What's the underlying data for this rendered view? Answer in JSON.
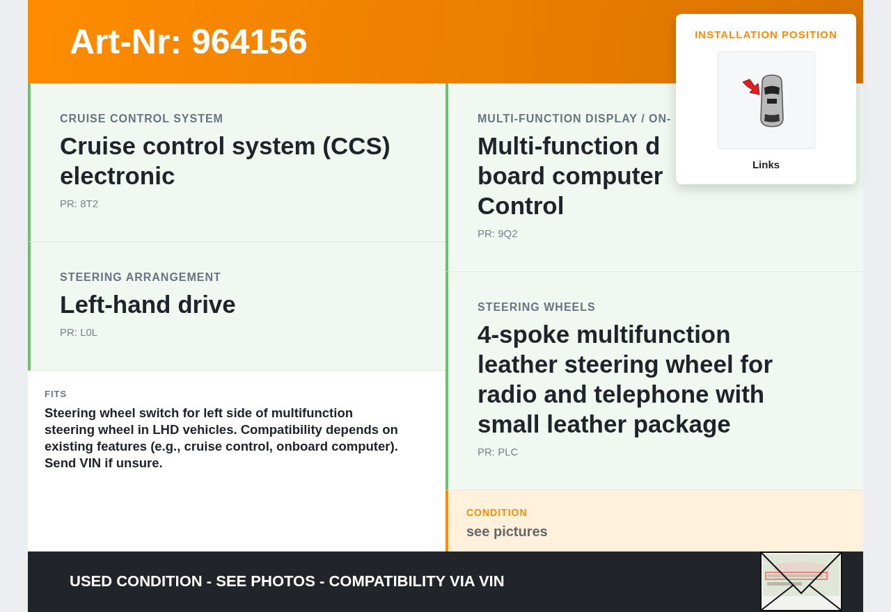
{
  "header": {
    "title": "Art-Nr: 964156"
  },
  "position_card": {
    "heading": "INSTALLATION POSITION",
    "caption": "Links"
  },
  "columns": [
    [
      {
        "kind": "feature",
        "label": "CRUISE CONTROL SYSTEM",
        "title": "Cruise control system (CCS) electronic",
        "pr": "PR: 8T2"
      },
      {
        "kind": "feature",
        "label": "STEERING ARRANGEMENT",
        "title": "Left-hand drive",
        "pr": "PR: L0L"
      },
      {
        "kind": "note",
        "label": "FITS",
        "text": "Steering wheel switch for left side of multifunction steering wheel in LHD vehicles. Compatibility depends on existing features (e.g., cruise control, onboard computer). Send VIN if unsure."
      }
    ],
    [
      {
        "kind": "feature",
        "label": "MULTI-FUNCTION DISPLAY / ON-",
        "title": "Multi-function d\nboard computer\nControl",
        "pr": "PR: 9Q2"
      },
      {
        "kind": "feature",
        "label": "STEERING WHEELS",
        "title": "4-spoke multifunction leather steering wheel for radio and telephone with small leather package",
        "pr": "PR: PLC"
      },
      {
        "kind": "condition",
        "label": "CONDITION",
        "text": "see pictures"
      }
    ]
  ],
  "footer": {
    "text": "USED CONDITION - SEE PHOTOS - COMPATIBILITY VIA VIN"
  }
}
